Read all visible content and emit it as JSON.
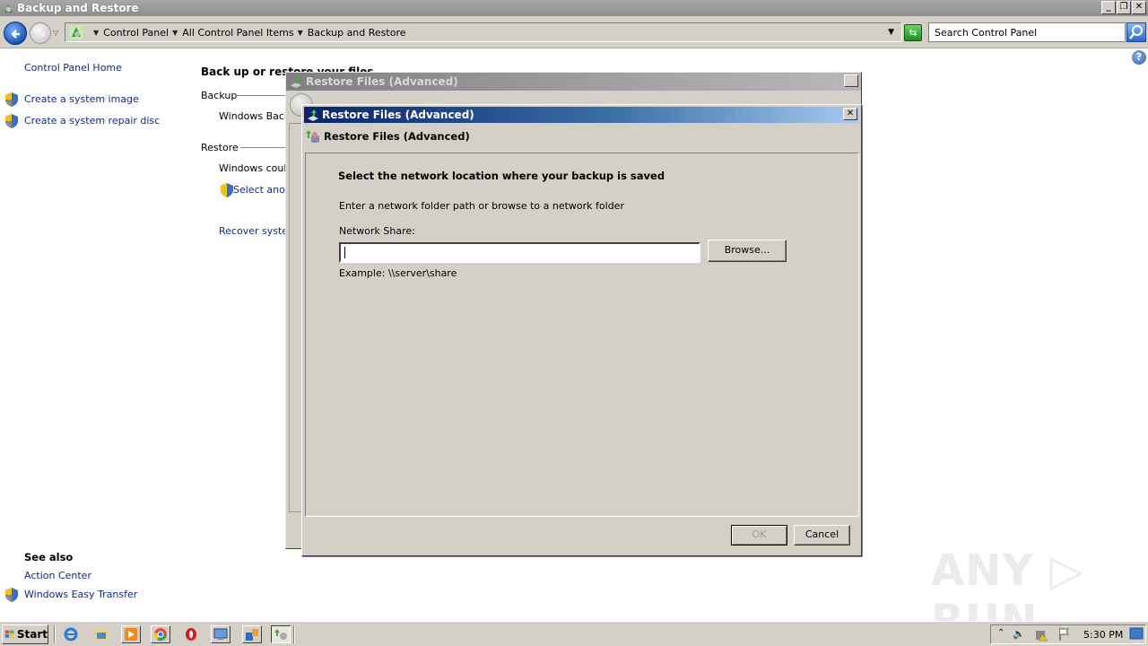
{
  "window": {
    "title": "Backup and Restore",
    "controls": {
      "minimize": "_",
      "restore": "❐",
      "close": "✕"
    }
  },
  "navbar": {
    "breadcrumbs": [
      "Control Panel",
      "All Control Panel Items",
      "Backup and Restore"
    ],
    "search_placeholder": "Search Control Panel",
    "help": "?"
  },
  "left_pane": {
    "home_link": "Control Panel Home",
    "tasks": [
      {
        "label": "Create a system image",
        "icon": "uac-shield-icon"
      },
      {
        "label": "Create a system repair disc",
        "icon": "uac-shield-icon"
      }
    ],
    "see_also_heading": "See also",
    "see_also": [
      {
        "label": "Action Center",
        "icon": null
      },
      {
        "label": "Windows Easy Transfer",
        "icon": "uac-shield-icon"
      }
    ]
  },
  "main": {
    "heading": "Back up or restore your files",
    "backup_section": "Backup",
    "backup_text": "Windows Backu",
    "restore_section": "Restore",
    "restore_text": "Windows could",
    "select_another_link": "Select anoth",
    "recover_link": "Recover systen"
  },
  "background_dialog": {
    "title": "Restore Files (Advanced)",
    "close": "✕"
  },
  "dialog": {
    "title": "Restore Files (Advanced)",
    "close": "✕",
    "header": "Restore Files (Advanced)",
    "instruction": "Select the network location where your backup is saved",
    "description": "Enter a network folder path or browse to a network folder",
    "network_share_label": "Network Share:",
    "network_share_value": "",
    "browse_button": "Browse...",
    "example": "Example: \\\\server\\share",
    "ok_button": "OK",
    "cancel_button": "Cancel"
  },
  "watermark": "ANY ▷ RUN",
  "taskbar": {
    "start_label": "Start",
    "pinned": [
      "internet-explorer-icon",
      "file-explorer-icon",
      "media-player-icon",
      "chrome-icon",
      "opera-icon",
      "remote-desktop-icon",
      "control-panel-icon",
      "backup-restore-icon"
    ],
    "clock": "5:30 PM"
  }
}
